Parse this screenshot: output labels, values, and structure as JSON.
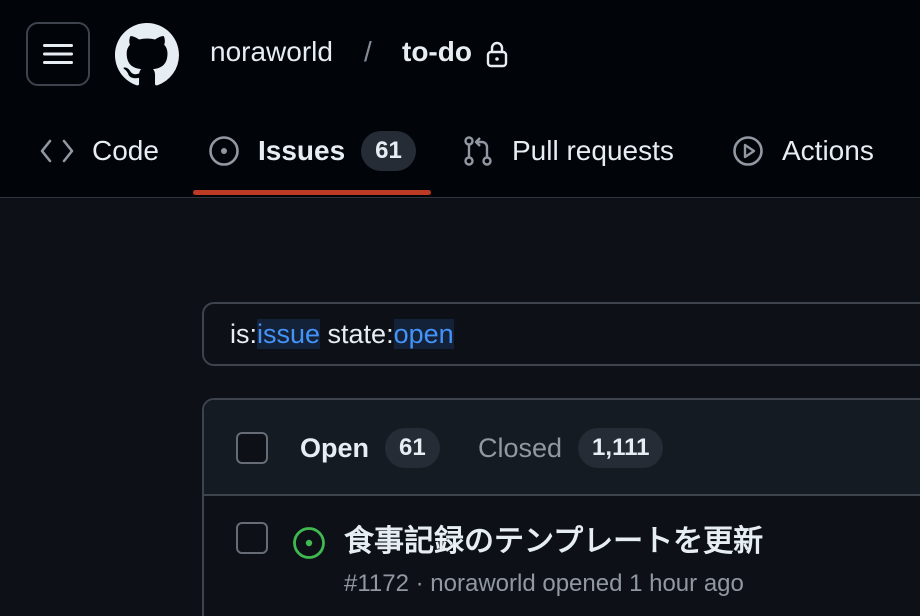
{
  "header": {
    "owner": "noraworld",
    "separator": "/",
    "repo": "to-do"
  },
  "tabs": [
    {
      "label": "Code"
    },
    {
      "label": "Issues",
      "count": "61"
    },
    {
      "label": "Pull requests"
    },
    {
      "label": "Actions"
    }
  ],
  "search": {
    "parts": [
      "is:",
      "issue",
      " state:",
      "open"
    ]
  },
  "list": {
    "open_label": "Open",
    "open_count": "61",
    "closed_label": "Closed",
    "closed_count": "1,111"
  },
  "issues": [
    {
      "title": "食事記録のテンプレートを更新",
      "meta": "#1172 · noraworld opened 1 hour ago"
    }
  ],
  "colors": {
    "accent_underline": "#bd3a25",
    "open_icon": "#3fb950",
    "search_value": "#4493f8"
  }
}
